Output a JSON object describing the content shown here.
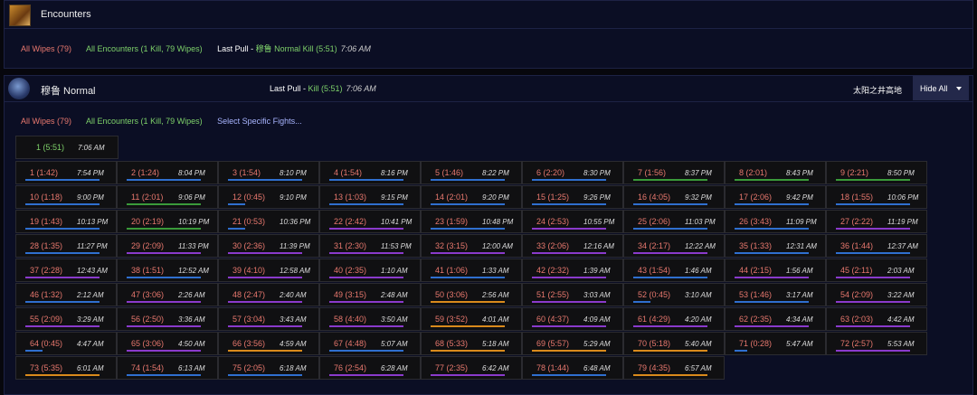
{
  "encounters": {
    "title": "Encounters",
    "all_wipes": "All Wipes (79)",
    "all_encounters": "All Encounters (1 Kill, 79 Wipes)",
    "last_pull_label": "Last Pull - ",
    "last_pull_value": "穆鲁 Normal Kill (5:51)",
    "last_pull_time": "7:06 AM"
  },
  "boss": {
    "title": "穆鲁 Normal",
    "last_pull_label": "Last Pull - ",
    "last_pull_value": "Kill (5:51)",
    "last_pull_time": "7:06 AM",
    "zone": "太阳之井高地",
    "hide_all": "Hide All",
    "all_wipes": "All Wipes (79)",
    "all_encounters": "All Encounters (1 Kill, 79 Wipes)",
    "select_fights": "Select Specific Fights..."
  },
  "kill": {
    "label": "1 (5:51)",
    "time": "7:06 AM"
  },
  "colors": {
    "kill": "#7ed16a",
    "wipe": "#e8786e",
    "bar_blue": "#2f6fcf",
    "bar_green": "#3a9a3a",
    "bar_purple": "#8a3acb",
    "bar_orange": "#d98a1c"
  },
  "fights": [
    {
      "label": "1 (1:42)",
      "time": "7:54 PM",
      "bar": "blue",
      "pct": 0.87
    },
    {
      "label": "2 (1:24)",
      "time": "8:04 PM",
      "bar": "blue",
      "pct": 0.87
    },
    {
      "label": "3 (1:54)",
      "time": "8:10 PM",
      "bar": "blue",
      "pct": 0.87
    },
    {
      "label": "4 (1:54)",
      "time": "8:16 PM",
      "bar": "blue",
      "pct": 0.87
    },
    {
      "label": "5 (1:46)",
      "time": "8:22 PM",
      "bar": "blue",
      "pct": 0.87
    },
    {
      "label": "6 (2:20)",
      "time": "8:30 PM",
      "bar": "blue",
      "pct": 0.87
    },
    {
      "label": "7 (1:56)",
      "time": "8:37 PM",
      "bar": "green",
      "pct": 0.87
    },
    {
      "label": "8 (2:01)",
      "time": "8:43 PM",
      "bar": "green",
      "pct": 0.87
    },
    {
      "label": "9 (2:21)",
      "time": "8:50 PM",
      "bar": "green",
      "pct": 0.87
    },
    {
      "label": "10 (1:18)",
      "time": "9:00 PM",
      "bar": "blue",
      "pct": 0.87
    },
    {
      "label": "11 (2:01)",
      "time": "9:06 PM",
      "bar": "green",
      "pct": 0.87
    },
    {
      "label": "12 (0:45)",
      "time": "9:10 PM",
      "bar": "blue",
      "pct": 0.2
    },
    {
      "label": "13 (1:03)",
      "time": "9:15 PM",
      "bar": "blue",
      "pct": 0.87
    },
    {
      "label": "14 (2:01)",
      "time": "9:20 PM",
      "bar": "blue",
      "pct": 0.87
    },
    {
      "label": "15 (1:25)",
      "time": "9:26 PM",
      "bar": "blue",
      "pct": 0.87
    },
    {
      "label": "16 (4:05)",
      "time": "9:32 PM",
      "bar": "blue",
      "pct": 0.87
    },
    {
      "label": "17 (2:06)",
      "time": "9:42 PM",
      "bar": "blue",
      "pct": 0.87
    },
    {
      "label": "18 (1:55)",
      "time": "10:06 PM",
      "bar": "blue",
      "pct": 0.87
    },
    {
      "label": "19 (1:43)",
      "time": "10:13 PM",
      "bar": "blue",
      "pct": 0.87
    },
    {
      "label": "20 (2:19)",
      "time": "10:19 PM",
      "bar": "green",
      "pct": 0.87
    },
    {
      "label": "21 (0:53)",
      "time": "10:36 PM",
      "bar": "blue",
      "pct": 0.2
    },
    {
      "label": "22 (2:42)",
      "time": "10:41 PM",
      "bar": "purple",
      "pct": 0.87
    },
    {
      "label": "23 (1:59)",
      "time": "10:48 PM",
      "bar": "blue",
      "pct": 0.87
    },
    {
      "label": "24 (2:53)",
      "time": "10:55 PM",
      "bar": "purple",
      "pct": 0.87
    },
    {
      "label": "25 (2:06)",
      "time": "11:03 PM",
      "bar": "blue",
      "pct": 0.87
    },
    {
      "label": "26 (3:43)",
      "time": "11:09 PM",
      "bar": "blue",
      "pct": 0.87
    },
    {
      "label": "27 (2:22)",
      "time": "11:19 PM",
      "bar": "purple",
      "pct": 0.87
    },
    {
      "label": "28 (1:35)",
      "time": "11:27 PM",
      "bar": "blue",
      "pct": 0.87
    },
    {
      "label": "29 (2:09)",
      "time": "11:33 PM",
      "bar": "purple",
      "pct": 0.87
    },
    {
      "label": "30 (2:36)",
      "time": "11:39 PM",
      "bar": "purple",
      "pct": 0.87
    },
    {
      "label": "31 (2:30)",
      "time": "11:53 PM",
      "bar": "purple",
      "pct": 0.87
    },
    {
      "label": "32 (3:15)",
      "time": "12:00 AM",
      "bar": "purple",
      "pct": 0.87
    },
    {
      "label": "33 (2:06)",
      "time": "12:16 AM",
      "bar": "purple",
      "pct": 0.87
    },
    {
      "label": "34 (2:17)",
      "time": "12:22 AM",
      "bar": "purple",
      "pct": 0.87
    },
    {
      "label": "35 (1:33)",
      "time": "12:31 AM",
      "bar": "blue",
      "pct": 0.87
    },
    {
      "label": "36 (1:44)",
      "time": "12:37 AM",
      "bar": "blue",
      "pct": 0.87
    },
    {
      "label": "37 (2:28)",
      "time": "12:43 AM",
      "bar": "purple",
      "pct": 0.87
    },
    {
      "label": "38 (1:51)",
      "time": "12:52 AM",
      "bar": "blue",
      "pct": 0.87
    },
    {
      "label": "39 (4:10)",
      "time": "12:58 AM",
      "bar": "purple",
      "pct": 0.87
    },
    {
      "label": "40 (2:35)",
      "time": "1:10 AM",
      "bar": "purple",
      "pct": 0.87
    },
    {
      "label": "41 (1:06)",
      "time": "1:33 AM",
      "bar": "blue",
      "pct": 0.87
    },
    {
      "label": "42 (2:32)",
      "time": "1:39 AM",
      "bar": "purple",
      "pct": 0.87
    },
    {
      "label": "43 (1:54)",
      "time": "1:46 AM",
      "bar": "blue",
      "pct": 0.87
    },
    {
      "label": "44 (2:15)",
      "time": "1:56 AM",
      "bar": "purple",
      "pct": 0.87
    },
    {
      "label": "45 (2:11)",
      "time": "2:03 AM",
      "bar": "purple",
      "pct": 0.87
    },
    {
      "label": "46 (1:32)",
      "time": "2:12 AM",
      "bar": "blue",
      "pct": 0.87
    },
    {
      "label": "47 (3:06)",
      "time": "2:26 AM",
      "bar": "purple",
      "pct": 0.87
    },
    {
      "label": "48 (2:47)",
      "time": "2:40 AM",
      "bar": "purple",
      "pct": 0.87
    },
    {
      "label": "49 (3:15)",
      "time": "2:48 AM",
      "bar": "purple",
      "pct": 0.87
    },
    {
      "label": "50 (3:06)",
      "time": "2:56 AM",
      "bar": "orange",
      "pct": 0.87
    },
    {
      "label": "51 (2:55)",
      "time": "3:03 AM",
      "bar": "purple",
      "pct": 0.87
    },
    {
      "label": "52 (0:45)",
      "time": "3:10 AM",
      "bar": "blue",
      "pct": 0.2
    },
    {
      "label": "53 (1:46)",
      "time": "3:17 AM",
      "bar": "blue",
      "pct": 0.87
    },
    {
      "label": "54 (2:09)",
      "time": "3:22 AM",
      "bar": "purple",
      "pct": 0.87
    },
    {
      "label": "55 (2:09)",
      "time": "3:29 AM",
      "bar": "purple",
      "pct": 0.87
    },
    {
      "label": "56 (2:50)",
      "time": "3:36 AM",
      "bar": "purple",
      "pct": 0.87
    },
    {
      "label": "57 (3:04)",
      "time": "3:43 AM",
      "bar": "purple",
      "pct": 0.87
    },
    {
      "label": "58 (4:40)",
      "time": "3:50 AM",
      "bar": "purple",
      "pct": 0.87
    },
    {
      "label": "59 (3:52)",
      "time": "4:01 AM",
      "bar": "orange",
      "pct": 0.87
    },
    {
      "label": "60 (4:37)",
      "time": "4:09 AM",
      "bar": "purple",
      "pct": 0.87
    },
    {
      "label": "61 (4:29)",
      "time": "4:20 AM",
      "bar": "purple",
      "pct": 0.87
    },
    {
      "label": "62 (2:35)",
      "time": "4:34 AM",
      "bar": "purple",
      "pct": 0.87
    },
    {
      "label": "63 (2:03)",
      "time": "4:42 AM",
      "bar": "purple",
      "pct": 0.87
    },
    {
      "label": "64 (0:45)",
      "time": "4:47 AM",
      "bar": "blue",
      "pct": 0.2
    },
    {
      "label": "65 (3:06)",
      "time": "4:50 AM",
      "bar": "purple",
      "pct": 0.87
    },
    {
      "label": "66 (3:56)",
      "time": "4:59 AM",
      "bar": "orange",
      "pct": 0.87
    },
    {
      "label": "67 (4:48)",
      "time": "5:07 AM",
      "bar": "blue",
      "pct": 0.87
    },
    {
      "label": "68 (5:33)",
      "time": "5:18 AM",
      "bar": "orange",
      "pct": 0.87
    },
    {
      "label": "69 (5:57)",
      "time": "5:29 AM",
      "bar": "orange",
      "pct": 0.87
    },
    {
      "label": "70 (5:18)",
      "time": "5:40 AM",
      "bar": "orange",
      "pct": 0.87
    },
    {
      "label": "71 (0:28)",
      "time": "5:47 AM",
      "bar": "blue",
      "pct": 0.15
    },
    {
      "label": "72 (2:57)",
      "time": "5:53 AM",
      "bar": "purple",
      "pct": 0.87
    },
    {
      "label": "73 (5:35)",
      "time": "6:01 AM",
      "bar": "orange",
      "pct": 0.87
    },
    {
      "label": "74 (1:54)",
      "time": "6:13 AM",
      "bar": "blue",
      "pct": 0.87
    },
    {
      "label": "75 (2:05)",
      "time": "6:18 AM",
      "bar": "blue",
      "pct": 0.87
    },
    {
      "label": "76 (2:54)",
      "time": "6:28 AM",
      "bar": "purple",
      "pct": 0.87
    },
    {
      "label": "77 (2:35)",
      "time": "6:42 AM",
      "bar": "purple",
      "pct": 0.87
    },
    {
      "label": "78 (1:44)",
      "time": "6:48 AM",
      "bar": "blue",
      "pct": 0.87
    },
    {
      "label": "79 (4:35)",
      "time": "6:57 AM",
      "bar": "orange",
      "pct": 0.87
    }
  ]
}
